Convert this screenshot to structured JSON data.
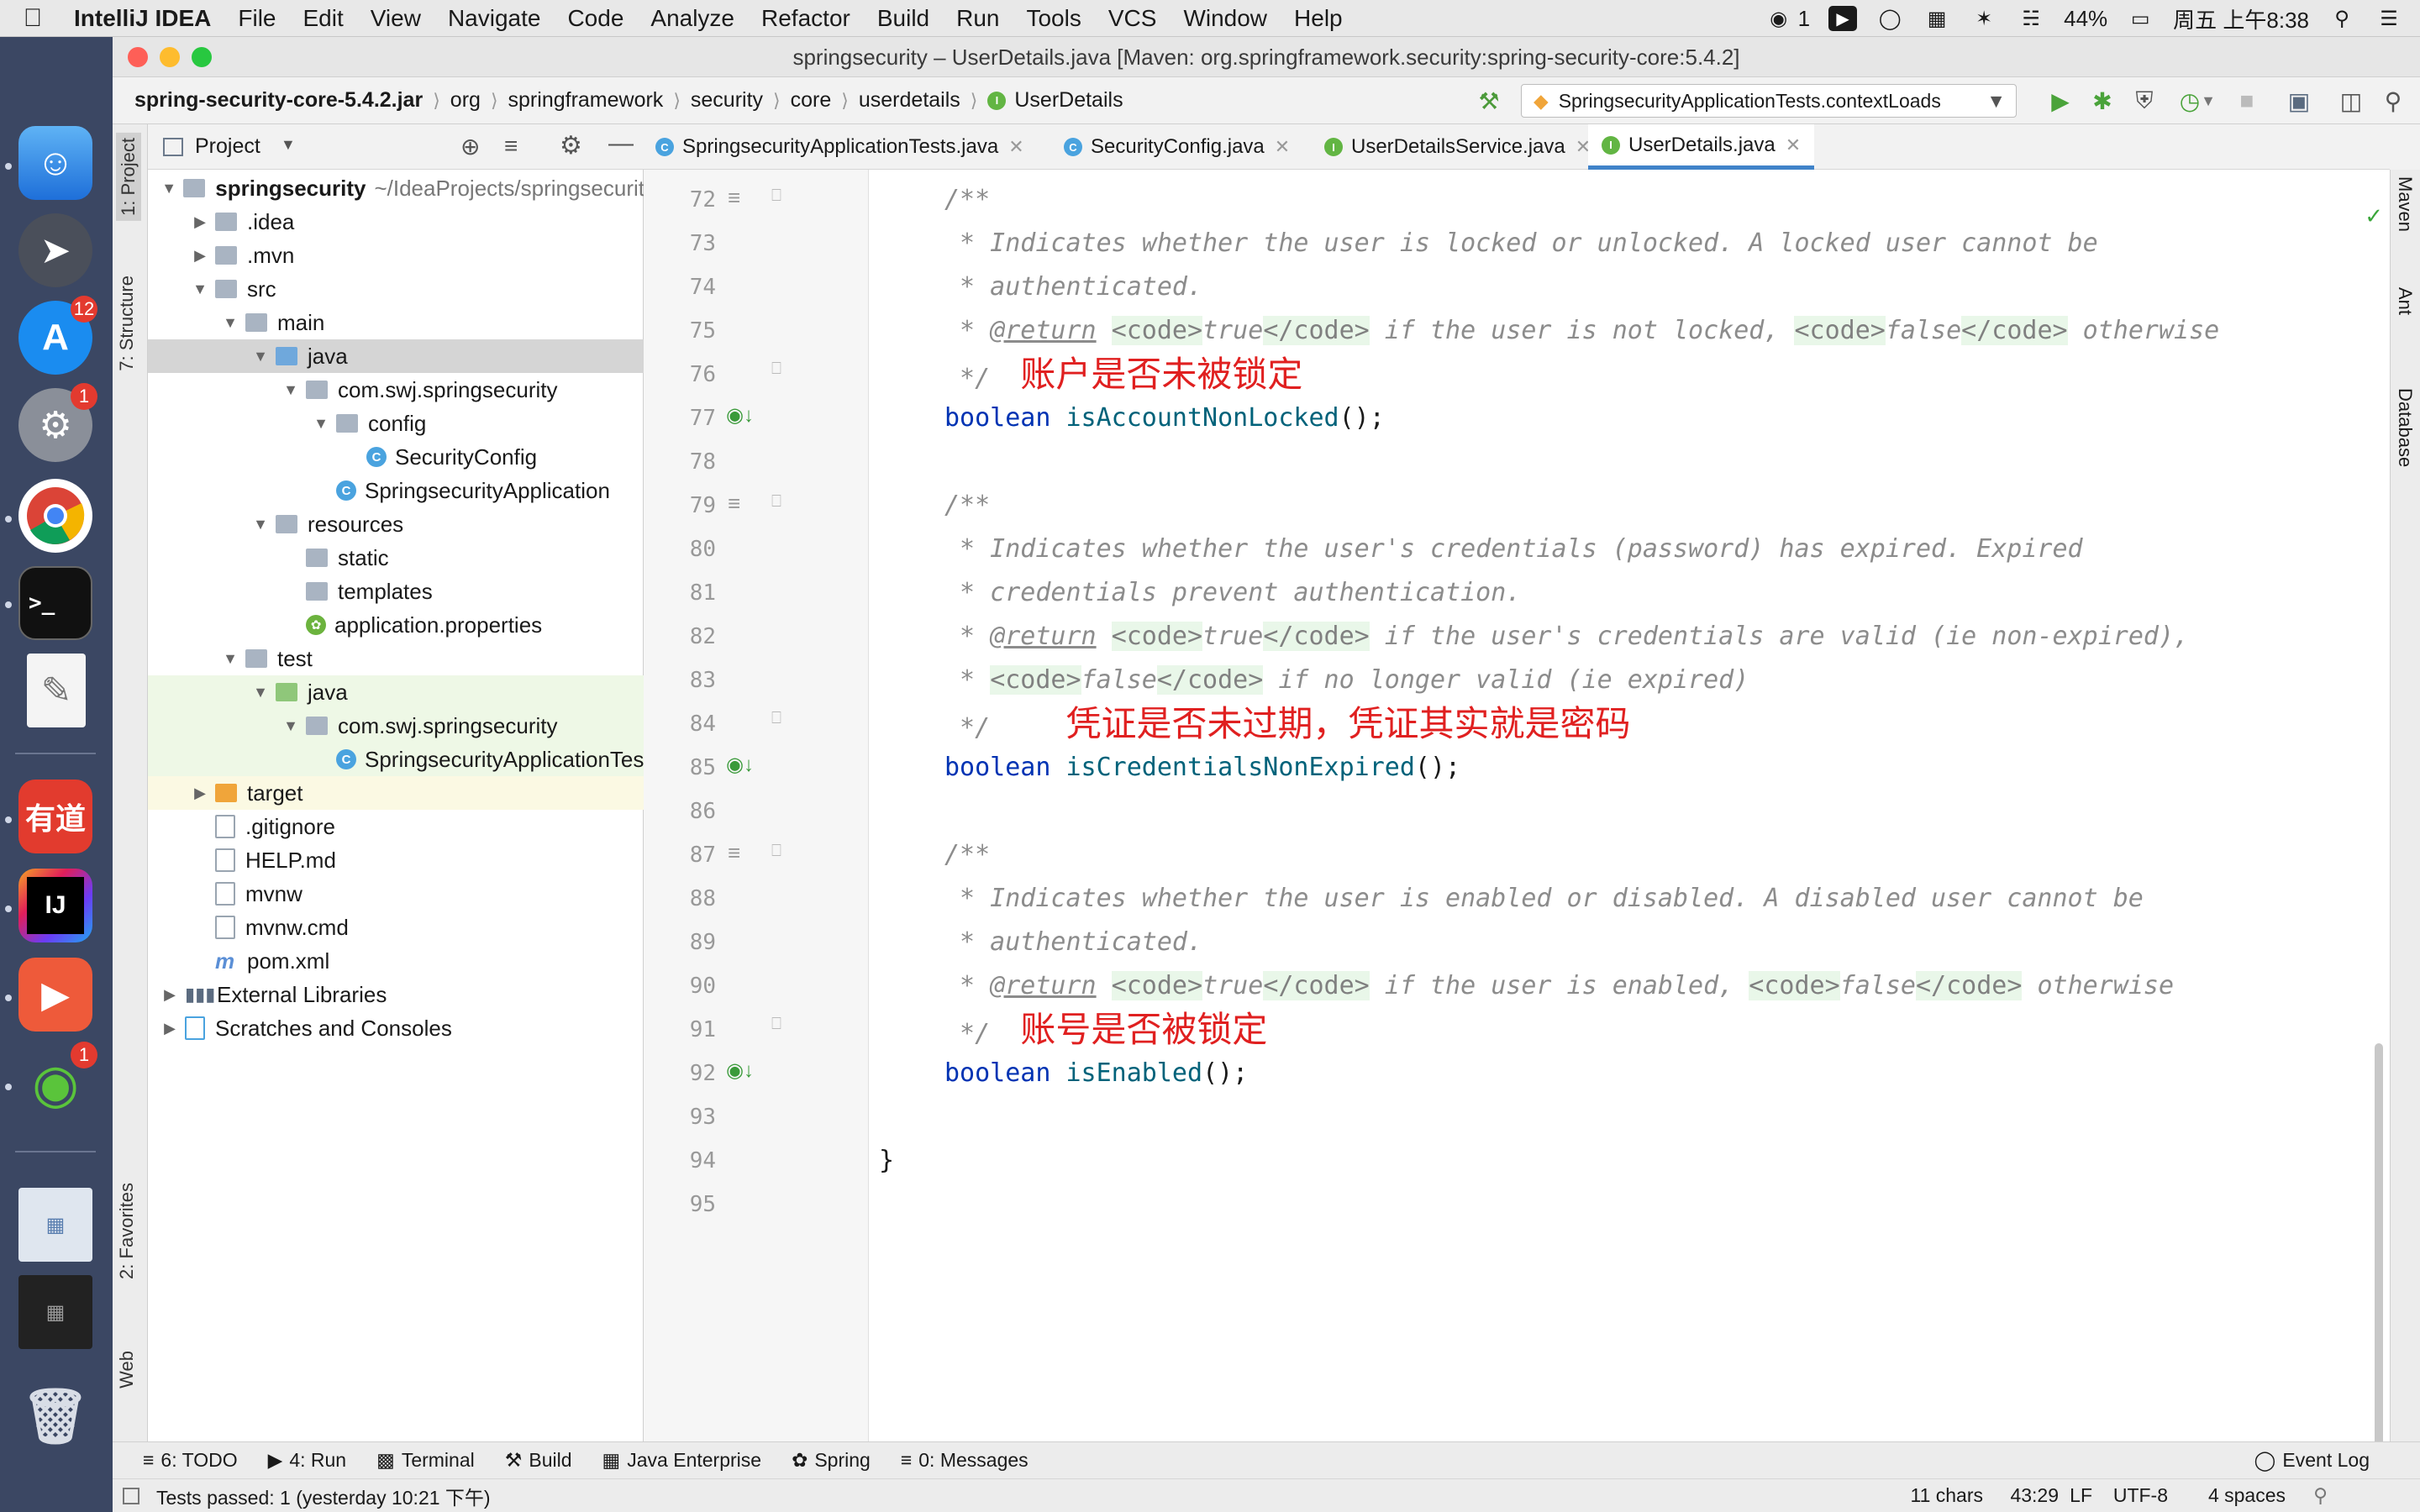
{
  "menubar": {
    "app_name": "IntelliJ IDEA",
    "items": [
      "File",
      "Edit",
      "View",
      "Navigate",
      "Code",
      "Analyze",
      "Refactor",
      "Build",
      "Run",
      "Tools",
      "VCS",
      "Window",
      "Help"
    ],
    "wechat_count": "1",
    "battery": "44%",
    "clock": "周五 上午8:38"
  },
  "dock": {
    "appstore_badge": "12",
    "settings_badge": "1",
    "wechat_badge": "1",
    "youdao_label": "有道",
    "intellij_label": "IJ",
    "terminal_label": ">_"
  },
  "window": {
    "title": "springsecurity – UserDetails.java [Maven: org.springframework.security:spring-security-core:5.4.2]"
  },
  "navbar": {
    "breadcrumbs": [
      "spring-security-core-5.4.2.jar",
      "org",
      "springframework",
      "security",
      "core",
      "userdetails",
      "UserDetails"
    ],
    "run_config": "SpringsecurityApplicationTests.contextLoads"
  },
  "project": {
    "header": "Project",
    "root_name": "springsecurity",
    "root_path": "~/IdeaProjects/springsecurity",
    "tree": [
      ".idea",
      ".mvn",
      "src",
      "main",
      "java",
      "com.swj.springsecurity",
      "config",
      "SecurityConfig",
      "SpringsecurityApplication",
      "resources",
      "static",
      "templates",
      "application.properties",
      "test",
      "java",
      "com.swj.springsecurity",
      "SpringsecurityApplicationTests",
      "target",
      ".gitignore",
      "HELP.md",
      "mvnw",
      "mvnw.cmd",
      "pom.xml",
      "External Libraries",
      "Scratches and Consoles"
    ]
  },
  "left_tabs": [
    "1: Project",
    "7: Structure",
    "2: Favorites",
    "Web"
  ],
  "right_tabs": [
    "Maven",
    "Ant",
    "Database"
  ],
  "editor_tabs": [
    "SpringsecurityApplicationTests.java",
    "SecurityConfig.java",
    "UserDetailsService.java",
    "UserDetails.java"
  ],
  "code": {
    "line_numbers": [
      "72",
      "73",
      "74",
      "75",
      "76",
      "77",
      "78",
      "79",
      "80",
      "81",
      "82",
      "83",
      "84",
      "85",
      "86",
      "87",
      "88",
      "89",
      "90",
      "91",
      "92",
      "93",
      "94",
      "95"
    ],
    "l72": "/**",
    "l73": " * Indicates whether the user is locked or unlocked. A locked user cannot be",
    "l74": " * authenticated.",
    "l75a": " * ",
    "return_tag": "@return",
    "l75b": " if the user is not locked, ",
    "l75c": " otherwise",
    "code_open": "<code>",
    "code_close": "</code>",
    "true_word": "true",
    "false_word": "false",
    "doc_end": " */",
    "note1": "账户是否未被锁定",
    "kw_boolean": "boolean",
    "m1": "isAccountNonLocked",
    "paren": "();",
    "l80": " * Indicates whether the user's credentials (password) has expired. Expired",
    "l81": " * credentials prevent authentication.",
    "l82b": " if the user's credentials are valid (ie non-expired),",
    "l83a": " * ",
    "l83b": " if no longer valid (ie expired)",
    "note2": "凭证是否未过期，凭证其实就是密码",
    "m2": "isCredentialsNonExpired",
    "l88": " * Indicates whether the user is enabled or disabled. A disabled user cannot be",
    "l89": " * authenticated.",
    "l90b": " if the user is enabled, ",
    "l90c": " otherwise",
    "note3": "账号是否被锁定",
    "m3": "isEnabled",
    "close_brace": "}"
  },
  "bottom_tabs": [
    "6: TODO",
    "4: Run",
    "Terminal",
    "Build",
    "Java Enterprise",
    "Spring",
    "0: Messages",
    "Event Log"
  ],
  "status": {
    "message": "Tests passed: 1 (yesterday 10:21 下午)",
    "chars": "11 chars",
    "position": "43:29",
    "line_sep": "LF",
    "encoding": "UTF-8",
    "indent": "4 spaces"
  },
  "colors": {
    "keyword": "#0033b3",
    "method": "#00627a",
    "annotation_note": "#e02020",
    "selection": "#d5d5d5",
    "test_folder_bg": "#eef8e6",
    "target_bg": "#fbf9e3",
    "active_tab_underline": "#4083c9"
  }
}
